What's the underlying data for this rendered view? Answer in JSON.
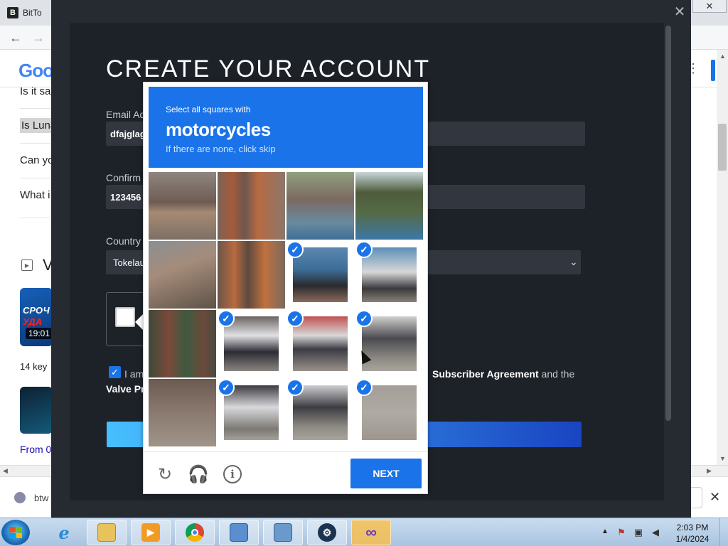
{
  "browser": {
    "tab_title": "BitTo",
    "tab_favicon": "B",
    "close_glyph": "✕",
    "back_glyph": "←",
    "forward_glyph": "→",
    "google_logo": "Goo",
    "kebab_glyph": "⋮",
    "paa": [
      "Is it sa",
      "Is Luna",
      "Can yo",
      "What i"
    ],
    "video_heading": "V",
    "video1": {
      "line1": "СРОЧ",
      "line2": "УДА",
      "duration": "19:01"
    },
    "key_text": "14 key",
    "from_text": "From 0",
    "bottom_text": "btw",
    "bottom_close": "✕"
  },
  "steam": {
    "close_glyph": "✕",
    "title": "CREATE YOUR ACCOUNT",
    "email_label": "Email Ad",
    "email_value": "dfajglag",
    "confirm_label": "Confirm",
    "confirm_value": "123456",
    "country_label": "Country",
    "country_value": "Tokelau",
    "chevron": "⌄",
    "check_glyph": "✓",
    "agree_prefix": "I am",
    "subscriber_text": "Subscriber Agreement",
    "and_the": " and the",
    "valve_text": "Valve Pr"
  },
  "captcha": {
    "instruction": "Select all squares with",
    "target": "motorcycles",
    "hint": "If there are none, click skip",
    "check_glyph": "✓",
    "reload_glyph": "↻",
    "audio_glyph": "🎧",
    "info_glyph": "i",
    "next_label": "NEXT",
    "tiles": [
      {
        "selected": false
      },
      {
        "selected": false
      },
      {
        "selected": false
      },
      {
        "selected": false
      },
      {
        "selected": false
      },
      {
        "selected": false
      },
      {
        "selected": true
      },
      {
        "selected": true
      },
      {
        "selected": false
      },
      {
        "selected": true
      },
      {
        "selected": true
      },
      {
        "selected": true
      },
      {
        "selected": false
      },
      {
        "selected": true
      },
      {
        "selected": true
      },
      {
        "selected": true
      }
    ]
  },
  "taskbar": {
    "apps": [
      "internet-explorer",
      "file-explorer",
      "media-player",
      "chrome",
      "control-panel",
      "network-tool",
      "steam",
      "infinity-app"
    ],
    "time": "2:03 PM",
    "date": "1/4/2024",
    "tray_arrow": "▲"
  },
  "colors": {
    "captcha_blue": "#1a73e8",
    "steam_bg": "#1d2128",
    "steam_button_start": "#47bfff",
    "steam_button_end": "#1a44c2"
  }
}
